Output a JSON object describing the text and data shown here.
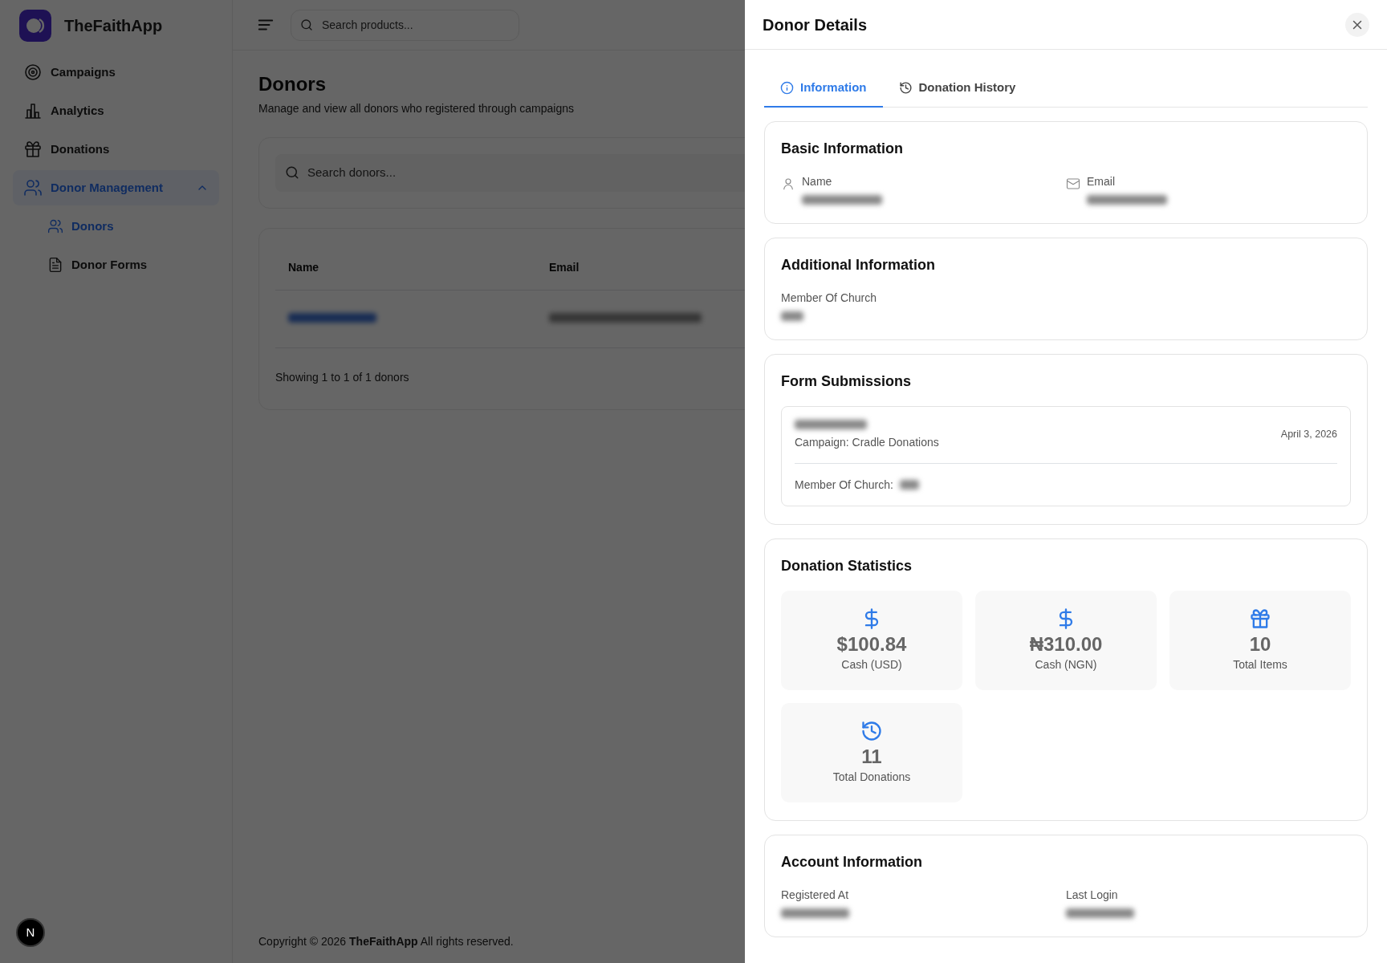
{
  "app": {
    "name": "TheFaithApp"
  },
  "sidebar": {
    "items": [
      {
        "label": "Campaigns",
        "selected": false
      },
      {
        "label": "Analytics",
        "selected": false
      },
      {
        "label": "Donations",
        "selected": false
      },
      {
        "label": "Donor Management",
        "selected": true,
        "expanded": true,
        "children": [
          {
            "label": "Donors",
            "selected": true
          },
          {
            "label": "Donor Forms",
            "selected": false
          }
        ]
      }
    ]
  },
  "header": {
    "search_placeholder": "Search products..."
  },
  "page": {
    "title": "Donors",
    "subtitle": "Manage and view all donors who registered through campaigns",
    "search_placeholder": "Search donors...",
    "table": {
      "columns": [
        "Name",
        "Email"
      ]
    },
    "summary": "Showing 1 to 1 of 1 donors"
  },
  "footer": {
    "copyright": "Copyright © 2026 **TheFaithApp** All rights reserved."
  },
  "dev_badge": {
    "label": "N"
  },
  "drawer": {
    "title": "Donor Details",
    "tabs": [
      {
        "label": "Information",
        "selected": true
      },
      {
        "label": "Donation History",
        "selected": false
      }
    ],
    "sections": [
      {
        "kind": "fields",
        "title": "Basic Information",
        "fields": [
          {
            "label": "Name"
          },
          {
            "label": "Email"
          }
        ]
      },
      {
        "kind": "fields",
        "title": "Additional Information",
        "fields": [
          {
            "label": "Member Of Church"
          }
        ]
      },
      {
        "kind": "submissions",
        "title": "Form Submissions",
        "submissions": [
          {
            "campaign": "Campaign: Cradle Donations",
            "date": "April 3, 2026",
            "detail": "Member Of Church:"
          }
        ]
      },
      {
        "kind": "stats",
        "title": "Donation Statistics",
        "stats": [
          {
            "value": "$100.84",
            "label": "Cash (USD)"
          },
          {
            "value": "₦310.00",
            "label": "Cash (NGN)"
          },
          {
            "value": "10",
            "label": "Total Items"
          },
          {
            "value": "11",
            "label": "Total Donations"
          }
        ]
      },
      {
        "kind": "fields",
        "title": "Account Information",
        "fields": [
          {
            "label": "Registered At"
          },
          {
            "label": "Last Login"
          }
        ]
      }
    ]
  }
}
